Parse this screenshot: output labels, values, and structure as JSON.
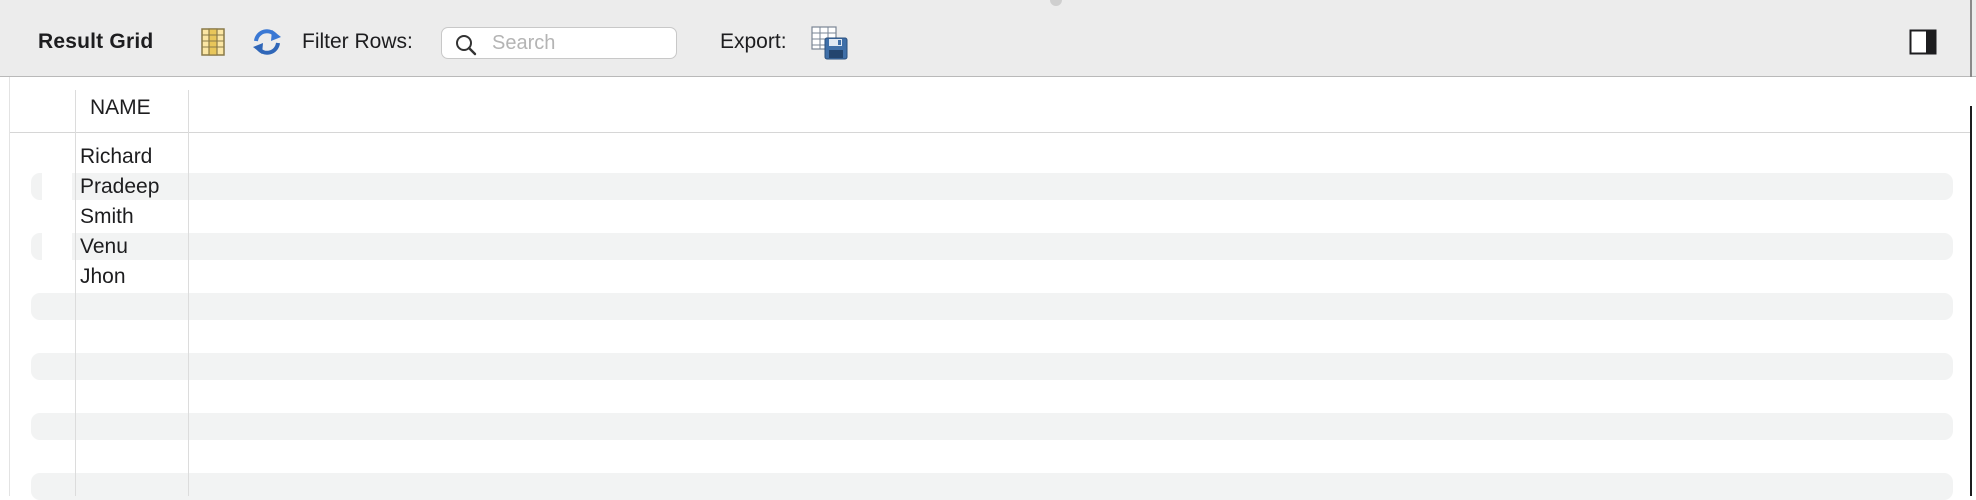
{
  "toolbar": {
    "title": "Result Grid",
    "filter_label": "Filter Rows:",
    "search_placeholder": "Search",
    "search_value": "",
    "export_label": "Export:",
    "icons": [
      "grid-columns-icon",
      "refresh-icon",
      "search-icon",
      "export-save-icon",
      "panel-toggle-icon"
    ]
  },
  "grid": {
    "columns": [
      "NAME"
    ],
    "rows": [
      {
        "name": "Richard"
      },
      {
        "name": "Pradeep"
      },
      {
        "name": "Smith"
      },
      {
        "name": "Venu"
      },
      {
        "name": "Jhon"
      }
    ]
  },
  "colors": {
    "toolbar_bg": "#ececec",
    "stripe": "#f2f3f3",
    "icon_blue": "#3a78d4",
    "icon_yellow": "#e8c65a"
  }
}
